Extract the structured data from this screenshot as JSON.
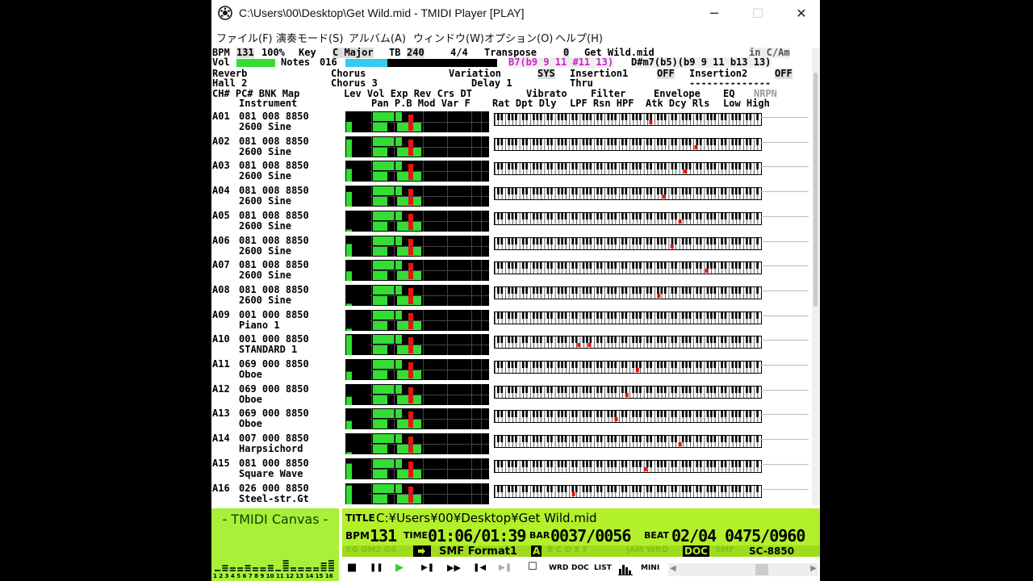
{
  "window": {
    "title": "C:\\Users\\00\\Desktop\\Get Wild.mid - TMIDI Player [PLAY]",
    "minimize": "─",
    "maximize": "☐",
    "close": "✕"
  },
  "menu": [
    "ファイル(F)",
    "演奏モード(S)",
    "アルバム(A)",
    "ウィンドウ(W)",
    "オプション(O)",
    "ヘルプ(H)"
  ],
  "status": {
    "bpm_label": "BPM",
    "bpm_value": "131",
    "percent": "100%",
    "key_label": "Key",
    "key_value": "C Major",
    "tb_label": "TB",
    "tb_value": "240",
    "time_sig": "4/4",
    "transpose_label": "Transpose",
    "transpose_value": "0",
    "file_name": "Get Wild.mid",
    "key_detect": "in C/Am",
    "vol_label": "Vol",
    "notes_label": "Notes",
    "notes_value": "016",
    "chord1": "B7(b9 9 11 #11 13)",
    "chord2": "D#m7(b5)(b9 9 11 b13 13)",
    "reverb_label": "Reverb",
    "reverb_value": "Hall 2",
    "chorus_label": "Chorus",
    "chorus_value": "Chorus 3",
    "variation_label": "Variation",
    "variation_value": "Delay 1",
    "sys_label": "SYS",
    "thru_label": "Thru",
    "insertion1_label": "Insertion1",
    "insertion1_value": "OFF",
    "insertion2_label": "Insertion2",
    "insertion2_value": "OFF",
    "dashes": "--------------",
    "header1": "CH# PC# BNK Map",
    "header1b": "Instrument",
    "header2": "Lev Vol Exp Rev Crs DT",
    "header2b": "Pan P.B Mod Var F",
    "header3": "Vibrato",
    "header3b": "Rat Dpt Dly",
    "header4": "Filter",
    "header4b": "LPF Rsn HPF",
    "header5": "Envelope",
    "header5b": "Atk Dcy Rls",
    "header6": "EQ",
    "header6b": "Low High",
    "header7": "NRPN"
  },
  "channels": [
    {
      "id": "A01",
      "pc": "081",
      "bank": "008",
      "map": "8850",
      "instrument": "2600 Sine",
      "level": 0.5,
      "notes": [
        0.58
      ]
    },
    {
      "id": "A02",
      "pc": "081",
      "bank": "008",
      "map": "8850",
      "instrument": "2600 Sine",
      "level": 0.85,
      "notes": [
        0.75
      ]
    },
    {
      "id": "A03",
      "pc": "081",
      "bank": "008",
      "map": "8850",
      "instrument": "2600 Sine",
      "level": 0.6,
      "notes": [
        0.71
      ]
    },
    {
      "id": "A04",
      "pc": "081",
      "bank": "008",
      "map": "8850",
      "instrument": "2600 Sine",
      "level": 0.7,
      "notes": [
        0.63
      ]
    },
    {
      "id": "A05",
      "pc": "081",
      "bank": "008",
      "map": "8850",
      "instrument": "2600 Sine",
      "level": 0.1,
      "notes": [
        0.69
      ]
    },
    {
      "id": "A06",
      "pc": "081",
      "bank": "008",
      "map": "8850",
      "instrument": "2600 Sine",
      "level": 0.6,
      "notes": [
        0.66
      ]
    },
    {
      "id": "A07",
      "pc": "081",
      "bank": "008",
      "map": "8850",
      "instrument": "2600 Sine",
      "level": 0.45,
      "notes": [
        0.79
      ]
    },
    {
      "id": "A08",
      "pc": "081",
      "bank": "008",
      "map": "8850",
      "instrument": "2600 Sine",
      "level": 0.1,
      "notes": [
        0.61
      ]
    },
    {
      "id": "A09",
      "pc": "001",
      "bank": "000",
      "map": "8850",
      "instrument": "Piano 1",
      "level": 0.1,
      "notes": []
    },
    {
      "id": "A10",
      "pc": "001",
      "bank": "000",
      "map": "8850",
      "instrument": "STANDARD 1",
      "level": 0.95,
      "notes": [
        0.31,
        0.35
      ]
    },
    {
      "id": "A11",
      "pc": "069",
      "bank": "000",
      "map": "8850",
      "instrument": "Oboe",
      "level": 0.4,
      "notes": [
        0.53
      ]
    },
    {
      "id": "A12",
      "pc": "069",
      "bank": "000",
      "map": "8850",
      "instrument": "Oboe",
      "level": 0.4,
      "notes": [
        0.49
      ]
    },
    {
      "id": "A13",
      "pc": "069",
      "bank": "000",
      "map": "8850",
      "instrument": "Oboe",
      "level": 0.4,
      "notes": [
        0.45
      ]
    },
    {
      "id": "A14",
      "pc": "007",
      "bank": "000",
      "map": "8850",
      "instrument": "Harpsichord",
      "level": 0.1,
      "notes": [
        0.69
      ]
    },
    {
      "id": "A15",
      "pc": "081",
      "bank": "000",
      "map": "8850",
      "instrument": "Square Wave",
      "level": 0.75,
      "notes": [
        0.56
      ]
    },
    {
      "id": "A16",
      "pc": "026",
      "bank": "000",
      "map": "8850",
      "instrument": "Steel-str.Gt",
      "level": 0.9,
      "notes": [
        0.29
      ]
    }
  ],
  "canvas": {
    "title": "- TMIDI Canvas -",
    "channel_numbers": "1 2 3 4 5 6 7 8 9 10 11 12 13 14 15 16",
    "levels": [
      0.1,
      0.25,
      0.2,
      0.15,
      0.25,
      0.2,
      0.15,
      0.3,
      0.1,
      0.5,
      0.2,
      0.2,
      0.2,
      0.15,
      0.35,
      0.45
    ]
  },
  "lcd": {
    "title_label": "TITLE",
    "title_value": "C:¥Users¥00¥Desktop¥Get Wild.mid",
    "bpm_label": "BPM",
    "bpm_value": "131",
    "time_label": "TIME",
    "time_value": "01:06/01:39",
    "bar_label": "BAR",
    "bar_value": "0037/0056",
    "beat_label": "BEAT",
    "beat_value": "02/04",
    "tick_value": "0475/0960",
    "format": "SMF Format1",
    "port": "A",
    "doc": "DOC",
    "module": "SC-8850",
    "dim_left": "XG GM2 GS",
    "dim_mid": "B C D E F",
    "dim_right": "JAM WRD",
    "dim_smf": "SMF"
  },
  "transport": {
    "stop": "■",
    "pause": "❚❚",
    "play": "▶",
    "step": "▶❚",
    "forward": "▶▶",
    "prev": "❚◀",
    "next": "▶❚",
    "window_btn": "☐",
    "wrd": "WRD",
    "doc": "DOC",
    "list": "LIST",
    "mini": "MINI"
  },
  "colors": {
    "lcd": "#b2f02c",
    "meter_green": "#33dd33",
    "meter_red": "#ee1111",
    "chord_magenta": "#cc22cc",
    "notes_cyan": "#33ccee"
  }
}
